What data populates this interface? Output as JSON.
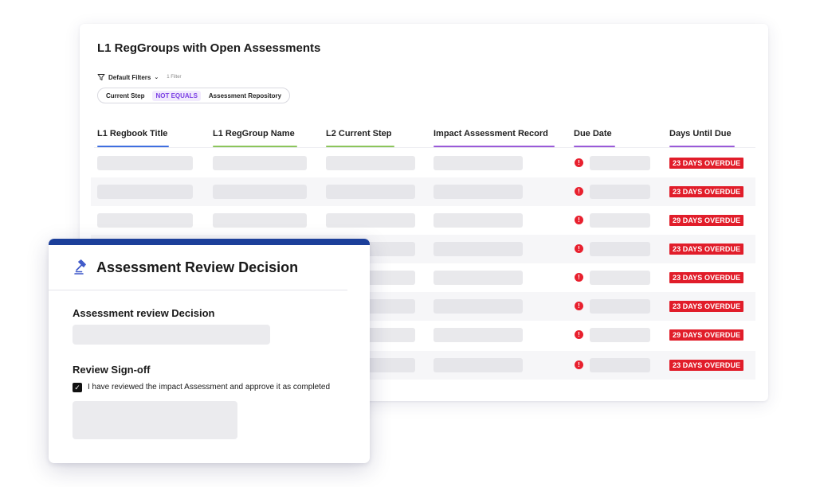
{
  "table": {
    "title": "L1 RegGroups with Open Assessments",
    "default_filters_label": "Default Filters",
    "filter_count": "1 Filter",
    "filter": {
      "field": "Current Step",
      "operator": "NOT EQUALS",
      "value": "Assessment Repository"
    },
    "columns": [
      {
        "label": "L1 Regbook Title",
        "accent": "#3f6fe0"
      },
      {
        "label": "L1 RegGroup Name",
        "accent": "#8cc55b"
      },
      {
        "label": "L2 Current Step",
        "accent": "#8cc55b"
      },
      {
        "label": "Impact Assessment Record",
        "accent": "#9a5ad8"
      },
      {
        "label": "Due Date",
        "accent": "#9a5ad8"
      },
      {
        "label": "Days Until Due",
        "accent": "#9a5ad8"
      }
    ],
    "rows": [
      {
        "status": "23 DAYS OVERDUE"
      },
      {
        "status": "23 DAYS OVERDUE"
      },
      {
        "status": "29 DAYS OVERDUE"
      },
      {
        "status": "23 DAYS OVERDUE"
      },
      {
        "status": "23 DAYS OVERDUE"
      },
      {
        "status": "23 DAYS OVERDUE"
      },
      {
        "status": "29 DAYS OVERDUE"
      },
      {
        "status": "23 DAYS OVERDUE"
      }
    ],
    "alert_icon": "alert-circle-icon",
    "overdue_color": "#e11d2a"
  },
  "modal": {
    "title": "Assessment Review Decision",
    "icon": "gavel-icon",
    "accent": "#1c3f9a",
    "decision_label": "Assessment review Decision",
    "signoff_label": "Review Sign-off",
    "checkbox_label": "I have reviewed the impact Assessment and approve it as completed",
    "checkbox_checked": true
  }
}
